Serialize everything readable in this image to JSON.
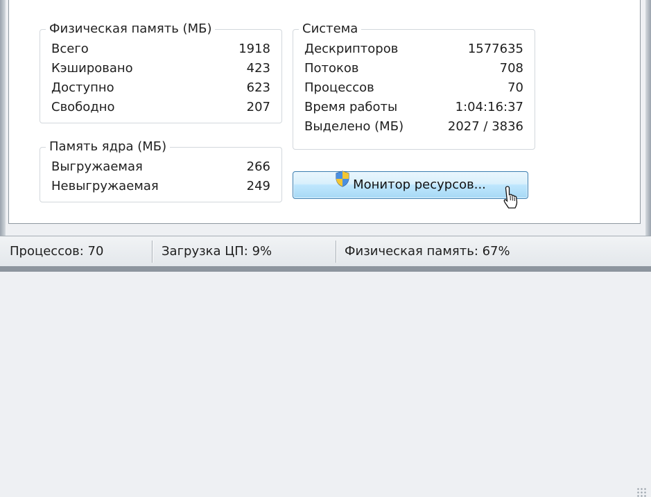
{
  "physical_memory": {
    "title": "Физическая память (МБ)",
    "rows": [
      {
        "label": "Всего",
        "value": "1918"
      },
      {
        "label": "Кэшировано",
        "value": "423"
      },
      {
        "label": "Доступно",
        "value": "623"
      },
      {
        "label": "Свободно",
        "value": "207"
      }
    ]
  },
  "kernel_memory": {
    "title": "Память ядра (МБ)",
    "rows": [
      {
        "label": "Выгружаемая",
        "value": "266"
      },
      {
        "label": "Невыгружаемая",
        "value": "249"
      }
    ]
  },
  "system": {
    "title": "Система",
    "rows": [
      {
        "label": "Дескрипторов",
        "value": "1577635"
      },
      {
        "label": "Потоков",
        "value": "708"
      },
      {
        "label": "Процессов",
        "value": "70"
      },
      {
        "label": "Время работы",
        "value": "1:04:16:37"
      },
      {
        "label": "Выделено (МБ)",
        "value": "2027 / 3836"
      }
    ]
  },
  "resource_monitor_button": {
    "label": "Монитор ресурсов...",
    "icon": "uac-shield-icon"
  },
  "statusbar": {
    "processes": "Процессов: 70",
    "cpu": "Загрузка ЦП: 9%",
    "memory": "Физическая память: 67%"
  },
  "colors": {
    "button_border": "#3c7fb1",
    "button_fill": "#bee6fd",
    "group_border": "#d2d7dc"
  }
}
